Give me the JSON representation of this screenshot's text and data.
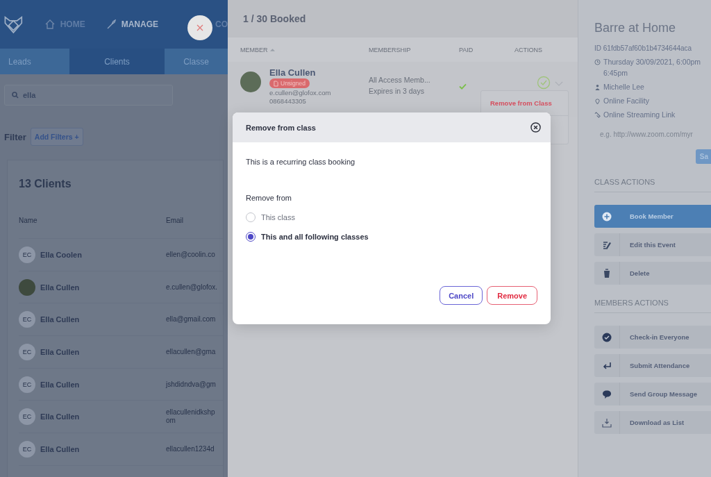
{
  "top_nav": [
    {
      "label": "HOME",
      "selected": false
    },
    {
      "label": "MANAGE",
      "selected": true
    },
    {
      "label": "CO",
      "selected": false
    }
  ],
  "tabs": [
    {
      "label": "Leads",
      "selected": false
    },
    {
      "label": "Clients",
      "selected": true
    },
    {
      "label": "Classe",
      "selected": false
    }
  ],
  "search": {
    "value": "ella"
  },
  "filter": {
    "label": "Filter",
    "button": "Add Filters +"
  },
  "clients": {
    "title": "13 Clients",
    "columns": [
      "Name",
      "Email"
    ],
    "rows": [
      {
        "name": "Ella Coolen",
        "initials": "EC",
        "photo": false,
        "email": "ellen@coolin.co"
      },
      {
        "name": "Ella Cullen",
        "initials": "",
        "photo": true,
        "email": "e.cullen@glofox."
      },
      {
        "name": "Ella Cullen",
        "initials": "EC",
        "photo": false,
        "email": "ella@gmail.com"
      },
      {
        "name": "Ella Cullen",
        "initials": "EC",
        "photo": false,
        "email": "ellacullen@gma"
      },
      {
        "name": "Ella Cullen",
        "initials": "EC",
        "photo": false,
        "email": "jshdidndva@gm"
      },
      {
        "name": "Ella Cullen",
        "initials": "EC",
        "photo": false,
        "email": "ellacullenidkshp\nom"
      },
      {
        "name": "Ella Cullen",
        "initials": "EC",
        "photo": false,
        "email": "ellacullen1234d"
      }
    ]
  },
  "booking": {
    "title": "1 / 30 Booked",
    "columns": [
      "MEMBER",
      "MEMBERSHIP",
      "PAID",
      "ACTIONS"
    ],
    "rows": [
      {
        "name": "Ella Cullen",
        "badge": "Unsigned",
        "email": "e.cullen@glofox.com",
        "phone": "0868443305",
        "membership": "All Access Memb...",
        "expiry": "Expires in 3 days",
        "paid": true
      }
    ]
  },
  "action_menu": {
    "items": [
      "Remove from Class"
    ]
  },
  "class_panel": {
    "title": "Barre at Home",
    "id": "ID 61fdb57af60b1b4734644aca",
    "details": [
      {
        "lines": [
          "Thursday 30/09/2021, 6:00pm",
          "6:45pm"
        ]
      },
      {
        "lines": [
          "Michelle Lee"
        ]
      },
      {
        "lines": [
          "Online Facility"
        ]
      },
      {
        "lines": [
          "Online Streaming Link"
        ]
      }
    ],
    "link_input": {
      "placeholder": "e.g. http://www.zoom.com/myr"
    },
    "save_button": "Sa"
  },
  "class_actions": {
    "heading": "CLASS ACTIONS",
    "items": [
      {
        "label": "Book Member",
        "primary": true
      },
      {
        "label": "Edit this Event",
        "primary": false
      },
      {
        "label": "Delete",
        "primary": false
      }
    ]
  },
  "member_actions": {
    "heading": "MEMBERS ACTIONS",
    "items": [
      {
        "label": "Check-in Everyone",
        "primary": false
      },
      {
        "label": "Submit Attendance",
        "primary": false
      },
      {
        "label": "Send Group Message",
        "primary": false
      },
      {
        "label": "Download as List",
        "primary": false
      }
    ]
  },
  "modal": {
    "title": "Remove from class",
    "message": "This is a recurring class booking",
    "group_label": "Remove from",
    "options": [
      {
        "label": "This class",
        "selected": false
      },
      {
        "label": "This and all following classes",
        "selected": true
      }
    ],
    "buttons": [
      {
        "label": "Cancel",
        "kind": "secondary"
      },
      {
        "label": "Remove",
        "kind": "danger"
      }
    ]
  }
}
